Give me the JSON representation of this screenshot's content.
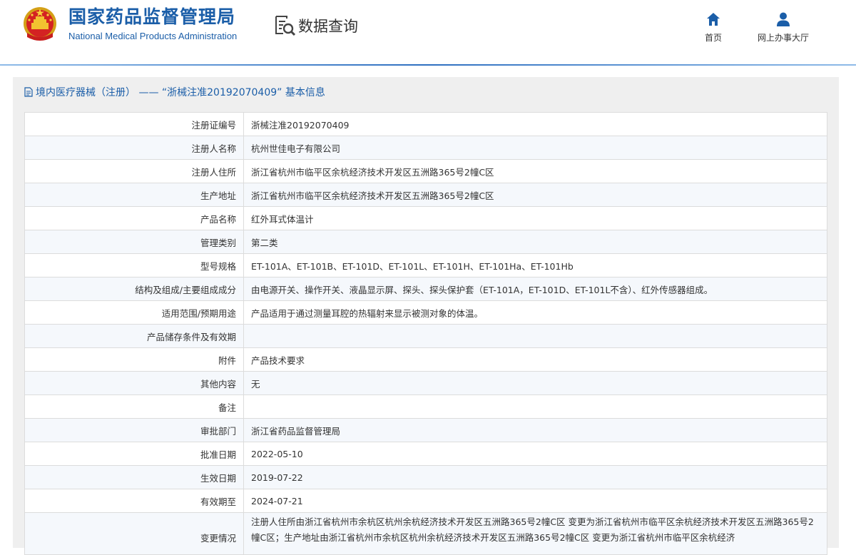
{
  "header": {
    "org_cn": "国家药品监督管理局",
    "org_en": "National Medical Products Administration",
    "query_label": "数据查询",
    "nav": [
      {
        "label": "首页",
        "icon": "home-icon"
      },
      {
        "label": "网上办事大厅",
        "icon": "user-icon"
      }
    ]
  },
  "panel": {
    "title": "境内医疗器械（注册） —— “浙械注准20192070409” 基本信息"
  },
  "rows": [
    {
      "key": "注册证编号",
      "value": "浙械注准20192070409"
    },
    {
      "key": "注册人名称",
      "value": "杭州世佳电子有限公司"
    },
    {
      "key": "注册人住所",
      "value": "浙江省杭州市临平区余杭经济技术开发区五洲路365号2幢C区"
    },
    {
      "key": "生产地址",
      "value": "浙江省杭州市临平区余杭经济技术开发区五洲路365号2幢C区"
    },
    {
      "key": "产品名称",
      "value": "红外耳式体温计"
    },
    {
      "key": "管理类别",
      "value": "第二类"
    },
    {
      "key": "型号规格",
      "value": "ET-101A、ET-101B、ET-101D、ET-101L、ET-101H、ET-101Ha、ET-101Hb"
    },
    {
      "key": "结构及组成/主要组成成分",
      "value": "由电源开关、操作开关、液晶显示屏、探头、探头保护套（ET-101A，ET-101D、ET-101L不含）、红外传感器组成。"
    },
    {
      "key": "适用范围/预期用途",
      "value": "产品适用于通过测量耳腔的热辐射来显示被测对象的体温。"
    },
    {
      "key": "产品储存条件及有效期",
      "value": ""
    },
    {
      "key": "附件",
      "value": "产品技术要求"
    },
    {
      "key": "其他内容",
      "value": "无"
    },
    {
      "key": "备注",
      "value": ""
    },
    {
      "key": "审批部门",
      "value": "浙江省药品监督管理局"
    },
    {
      "key": "批准日期",
      "value": "2022-05-10"
    },
    {
      "key": "生效日期",
      "value": "2019-07-22"
    },
    {
      "key": "有效期至",
      "value": "2024-07-21"
    },
    {
      "key": "变更情况",
      "value": "注册人住所由浙江省杭州市余杭区杭州余杭经济技术开发区五洲路365号2幢C区 变更为浙江省杭州市临平区余杭经济技术开发区五洲路365号2幢C区；生产地址由浙江省杭州市余杭区杭州余杭经济技术开发区五洲路365号2幢C区 变更为浙江省杭州市临平区余杭经济"
    }
  ]
}
